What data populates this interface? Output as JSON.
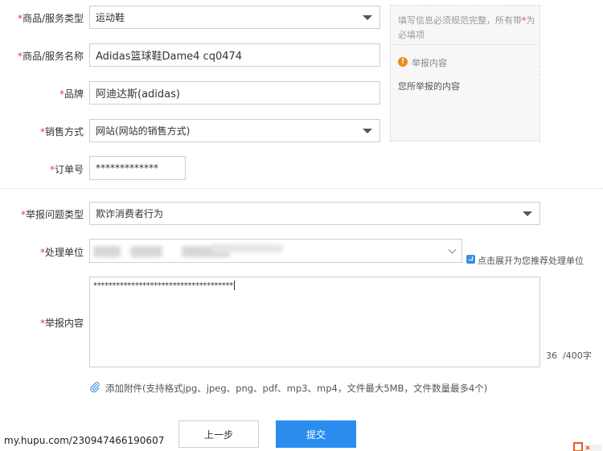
{
  "form": {
    "goods_type": {
      "label": "商品/服务类型",
      "value": "运动鞋"
    },
    "goods_name": {
      "label": "商品/服务名称",
      "value": "Adidas篮球鞋Dame4 cq0474"
    },
    "brand": {
      "label": "品牌",
      "value": "阿迪达斯(adidas)"
    },
    "sale_method": {
      "label": "销售方式",
      "value": "网站(网站的销售方式)"
    },
    "order_no": {
      "label": "订单号",
      "value": "*************"
    },
    "problem_type": {
      "label": "举报问题类型",
      "value": "欺诈消费者行为"
    },
    "handler": {
      "label": "处理单位",
      "expand_text": "点击展开为您推荐处理单位"
    },
    "content": {
      "label": "举报内容",
      "value": "*************************************",
      "count": "36",
      "max": "/400字"
    },
    "required_mark": "*",
    "attachment_text": "添加附件(支持格式jpg、jpeg、png、pdf、mp3、mp4，文件最大5MB，文件数量最多4个)"
  },
  "panel": {
    "hint_text": "填写信息必须规范完整，所有带",
    "hint_mark": "*",
    "hint_suffix": "为必填项",
    "info_icon": "!",
    "info_title": "举报内容",
    "info_body": "您所举报的内容"
  },
  "buttons": {
    "prev": "上一步",
    "submit": "提交"
  },
  "watermark": "my.hupu.com/230947466190607",
  "colors": {
    "accent": "#2b8cf0",
    "required": "#e4393c",
    "info": "#f08a1c"
  },
  "icons": {
    "dropdown": "caret-down-icon",
    "chevron": "chevron-down-icon",
    "expand": "expand-icon",
    "attach": "paperclip-icon",
    "info": "info-icon"
  }
}
